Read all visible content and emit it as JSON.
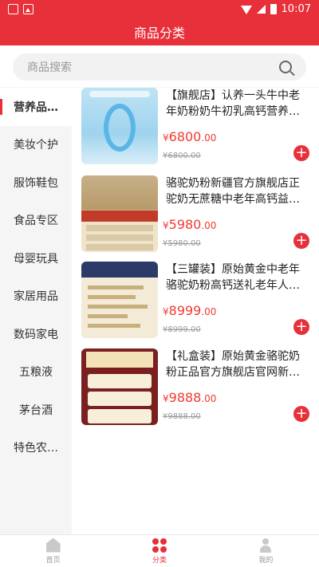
{
  "status_bar": {
    "time": "10:07"
  },
  "header": {
    "title": "商品分类"
  },
  "search": {
    "placeholder": "商品搜索"
  },
  "categories": [
    {
      "label": "营养品…",
      "active": true
    },
    {
      "label": "美妆个护"
    },
    {
      "label": "服饰鞋包"
    },
    {
      "label": "食品专区"
    },
    {
      "label": "母婴玩具"
    },
    {
      "label": "家居用品"
    },
    {
      "label": "数码家电"
    },
    {
      "label": "五粮液"
    },
    {
      "label": "茅台酒"
    },
    {
      "label": "特色农…"
    }
  ],
  "products": [
    {
      "name": "【旗舰店】认养一头牛中老年奶粉奶牛初乳高钙营养奶…",
      "currency": "¥",
      "price_int": "6800",
      "price_dec": ".00",
      "original_price": "¥6800.00"
    },
    {
      "name": "骆驼奶粉新疆官方旗舰店正驼奶无蔗糖中老年高钙益…",
      "currency": "¥",
      "price_int": "5980",
      "price_dec": ".00",
      "original_price": "¥5980.00"
    },
    {
      "name": "【三罐装】原始黄金中老年骆驼奶粉高钙送礼老年人…",
      "currency": "¥",
      "price_int": "8999",
      "price_dec": ".00",
      "original_price": "¥8999.00"
    },
    {
      "name": "【礼盒装】原始黄金骆驼奶粉正品官方旗舰店官网新…",
      "currency": "¥",
      "price_int": "9888",
      "price_dec": ".00",
      "original_price": "¥9888.00"
    }
  ],
  "tabbar": [
    {
      "label": "首页"
    },
    {
      "label": "分类",
      "active": true
    },
    {
      "label": "我的"
    }
  ],
  "colors": {
    "primary": "#e8303a",
    "price": "#f03a30"
  }
}
